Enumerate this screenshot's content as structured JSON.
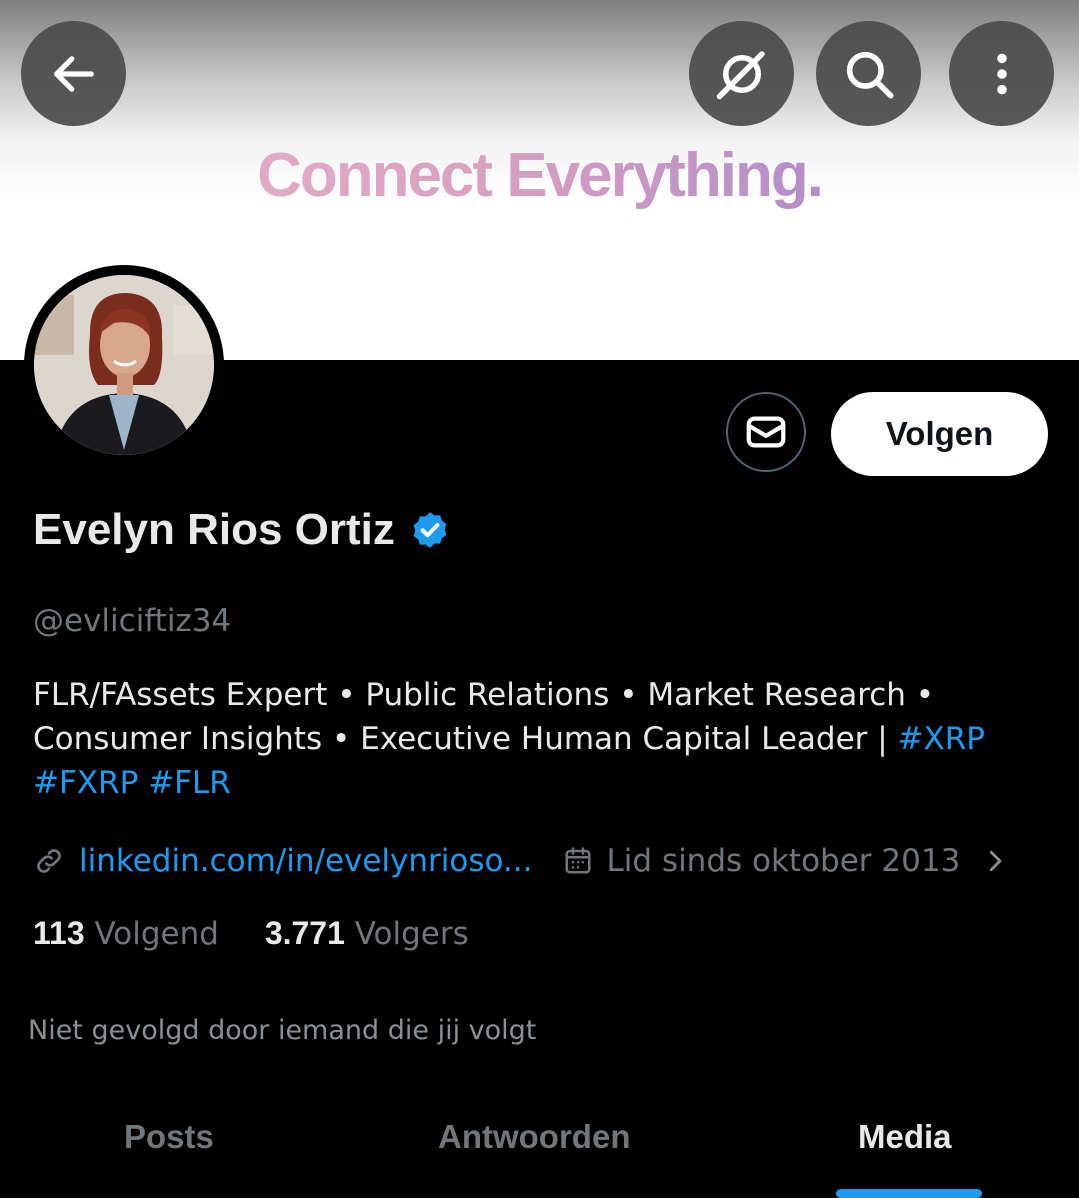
{
  "banner": {
    "text": "Connect Everything."
  },
  "header": {
    "back_icon": "arrow-left-icon",
    "grok_icon": "grok-icon",
    "search_icon": "search-icon",
    "more_icon": "more-vertical-icon"
  },
  "profile": {
    "name": "Evelyn Rios Ortiz",
    "verified": true,
    "handle": "@evliciftiz34",
    "bio_text": "FLR/FAssets Expert • Public Relations • Market Research • Consumer Insights • Executive Human Capital Leader | ",
    "bio_hashtags": [
      "#XRP",
      "#FXRP",
      "#FLR"
    ],
    "link": "linkedin.com/in/evelynrioso...",
    "joined": "Lid sinds oktober 2013",
    "following_count": "113",
    "following_label": "Volgend",
    "followers_count": "3.771",
    "followers_label": "Volgers",
    "not_followed": "Niet gevolgd door iemand die jij volgt"
  },
  "actions": {
    "follow_label": "Volgen"
  },
  "tabs": [
    {
      "label": "Posts",
      "active": false
    },
    {
      "label": "Antwoorden",
      "active": false
    },
    {
      "label": "Media",
      "active": true
    }
  ],
  "colors": {
    "accent": "#1d9bf0",
    "background": "#000000",
    "muted": "#71767b"
  }
}
